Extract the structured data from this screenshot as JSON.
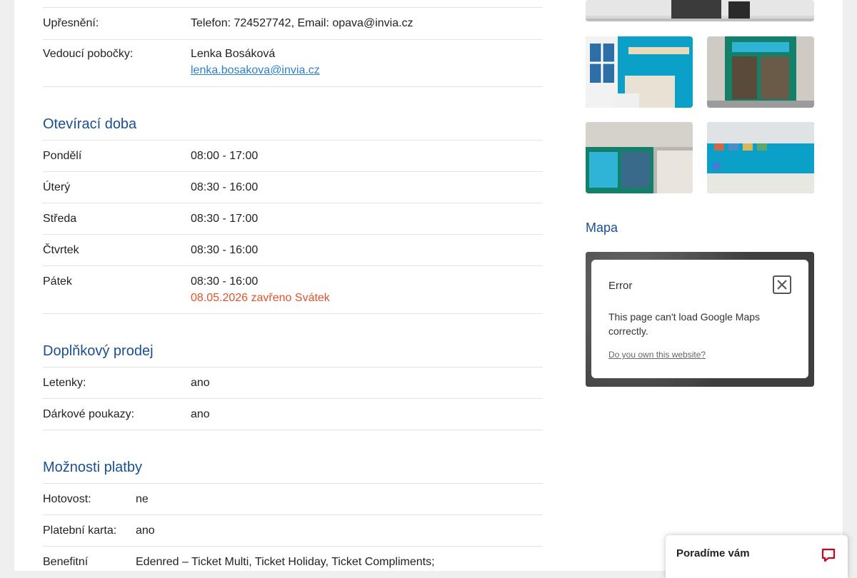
{
  "branch": {
    "details_label": "Upřesnění:",
    "details_value": "Telefon: 724527742, Email: opava@invia.cz",
    "manager_label": "Vedoucí pobočky:",
    "manager_name": "Lenka Bosáková",
    "manager_email": "lenka.bosakova@invia.cz"
  },
  "hours": {
    "title": "Otevírací doba",
    "days": [
      {
        "day": "Pondělí",
        "time": "08:00 - 17:00"
      },
      {
        "day": "Úterý",
        "time": "08:30 - 16:00"
      },
      {
        "day": "Středa",
        "time": "08:30 - 17:00"
      },
      {
        "day": "Čtvrtek",
        "time": "08:30 - 16:00"
      },
      {
        "day": "Pátek",
        "time": "08:30 - 16:00",
        "note": "08.05.2026 zavřeno Svátek"
      }
    ]
  },
  "extras": {
    "title": "Doplňkový prodej",
    "items": [
      {
        "label": "Letenky:",
        "value": "ano"
      },
      {
        "label": "Dárkové poukazy:",
        "value": "ano"
      }
    ]
  },
  "payment": {
    "title": "Možnosti platby",
    "items": [
      {
        "label": "Hotovost:",
        "value": "ne"
      },
      {
        "label": "Platební karta:",
        "value": "ano"
      },
      {
        "label": "Benefitní",
        "value": "Edenred – Ticket Multi, Ticket Holiday, Ticket Compliments;"
      }
    ]
  },
  "map": {
    "title": "Mapa",
    "error_title": "Error",
    "error_message": "This page can't load Google Maps correctly.",
    "error_link": "Do you own this website?"
  },
  "chat": {
    "label": "Poradíme vám"
  },
  "colors": {
    "heading": "#1a4f93",
    "link": "#2a7fd4",
    "holiday_note": "#e2532b",
    "photo_wall": "#0aa0c8"
  }
}
